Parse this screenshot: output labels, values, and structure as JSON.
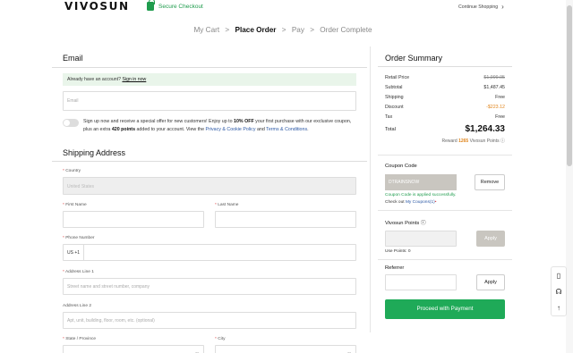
{
  "header": {
    "logo": "VIVOSUN",
    "secure_checkout": "Secure Checkout",
    "continue_shopping": "Continue Shopping",
    "continue_arrow": "›"
  },
  "steps": [
    {
      "label": "My Cart",
      "active": false
    },
    {
      "label": "Place Order",
      "active": true
    },
    {
      "label": "Pay",
      "active": false
    },
    {
      "label": "Order Complete",
      "active": false
    }
  ],
  "step_separator": ">",
  "email_section": {
    "title": "Email",
    "account_prompt": "Already have an account?",
    "sign_in": "Sign in now",
    "email_placeholder": "Email",
    "signup_text_1": "Sign up now and receive a special offer for new customers! Enjoy up to ",
    "signup_highlight_1": "10% OFF",
    "signup_text_2": " your first purchase with our exclusive coupon, plus an extra ",
    "signup_highlight_2": "420 points",
    "signup_text_3": " added to your account. View the ",
    "privacy_link": "Privacy & Cookie Policy",
    "and": " and ",
    "terms_link": "Terms & Conditions",
    "period": "."
  },
  "shipping": {
    "title": "Shipping Address",
    "country_label": "Country",
    "country_value": "United States",
    "first_name_label": "First Name",
    "last_name_label": "Last Name",
    "phone_label": "Phone Number",
    "phone_prefix": "US +1",
    "address1_label": "Address Line 1",
    "address1_placeholder": "Street name and street number, company",
    "address2_label": "Address Line 2",
    "address2_placeholder": "Apt, unit, building, floor, room, etc. (optional)",
    "state_label": "State / Province",
    "city_label": "City",
    "required_mark": "*"
  },
  "summary": {
    "title": "Order Summary",
    "rows": [
      {
        "label": "Retail Price",
        "value": "$1,999.95",
        "style": "strike"
      },
      {
        "label": "Subtotal",
        "value": "$1,487.45",
        "style": ""
      },
      {
        "label": "Shipping",
        "value": "Free",
        "style": ""
      },
      {
        "label": "Discount",
        "value": "-$223.12",
        "style": "disc"
      },
      {
        "label": "Tax",
        "value": "Free",
        "style": ""
      }
    ],
    "total_label": "Total",
    "total_value": "$1,264.33",
    "reward_prefix": "Reward ",
    "reward_points": "1265",
    "reward_suffix": " Vivosun Points",
    "info_icon": "ⓘ"
  },
  "coupon": {
    "title": "Coupon Code",
    "code": "DTRAINSNOW",
    "remove": "Remove",
    "applied_msg": "Coupon Code is applied successfully.",
    "check_out": "Check out ",
    "my_coupons": "My Coupons",
    "coupon_count": "(1)"
  },
  "points": {
    "title": "Vivosun Points",
    "apply": "Apply",
    "use_points": "Use Points: 0"
  },
  "referrer": {
    "title": "Referrer",
    "apply": "Apply"
  },
  "proceed": "Proceed with Payment",
  "colors": {
    "green": "#1faa58",
    "accent_orange": "#e0851c",
    "link_blue": "#2b58a5"
  }
}
